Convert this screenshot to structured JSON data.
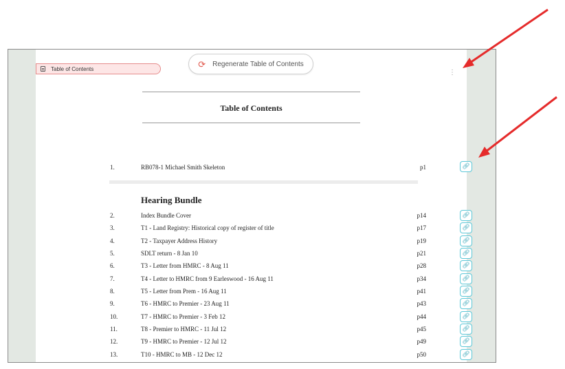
{
  "tab_label": "Table of Contents",
  "regen_label": "Regenerate Table of Contents",
  "toc_title": "Table of Contents",
  "section_heading": "Hearing Bundle",
  "entries": [
    {
      "num": "1.",
      "title": "RB078-1 Michael Smith Skeleton",
      "page": "p1"
    },
    {
      "num": "2.",
      "title": "Index Bundle Cover",
      "page": "p14"
    },
    {
      "num": "3.",
      "title": "T1 - Land Registry: Historical copy of register of title",
      "page": "p17"
    },
    {
      "num": "4.",
      "title": "T2 - Taxpayer Address History",
      "page": "p19"
    },
    {
      "num": "5.",
      "title": "SDLT return - 8 Jan 10",
      "page": "p21"
    },
    {
      "num": "6.",
      "title": "T3 - Letter from HMRC - 8 Aug 11",
      "page": "p28"
    },
    {
      "num": "7.",
      "title": "T4 - Letter to HMRC from 9 Earleswood - 16 Aug 11",
      "page": "p34"
    },
    {
      "num": "8.",
      "title": "T5 - Letter from Prem - 16 Aug 11",
      "page": "p41"
    },
    {
      "num": "9.",
      "title": "T6 - HMRC to Premier - 23 Aug 11",
      "page": "p43"
    },
    {
      "num": "10.",
      "title": "T7 - HMRC to Premier - 3 Feb 12",
      "page": "p44"
    },
    {
      "num": "11.",
      "title": "T8 - Premier to HMRC - 11 Jul 12",
      "page": "p45"
    },
    {
      "num": "12.",
      "title": "T9 - HMRC to Premier - 12 Jul 12",
      "page": "p49"
    },
    {
      "num": "13.",
      "title": "T10 - HMRC to MB - 12 Dec 12",
      "page": "p50"
    }
  ],
  "icons": {
    "document": "document-icon",
    "refresh": "refresh-icon",
    "more": "kebab-menu-icon",
    "link": "link-icon"
  },
  "colors": {
    "tab_bg": "#fde6e6",
    "tab_border": "#e58c8c",
    "link_border": "#5cc8d8",
    "arrow": "#e52b2b",
    "frame_bg": "#e3e8e3"
  }
}
